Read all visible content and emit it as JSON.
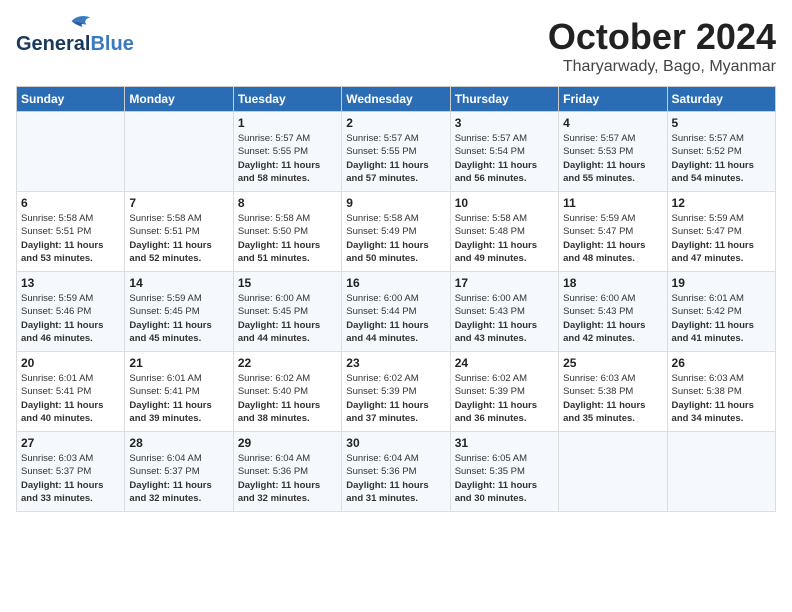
{
  "header": {
    "logo_general": "General",
    "logo_blue": "Blue",
    "month_year": "October 2024",
    "location": "Tharyarwady, Bago, Myanmar"
  },
  "days_of_week": [
    "Sunday",
    "Monday",
    "Tuesday",
    "Wednesday",
    "Thursday",
    "Friday",
    "Saturday"
  ],
  "weeks": [
    [
      {
        "day": "",
        "info": ""
      },
      {
        "day": "",
        "info": ""
      },
      {
        "day": "1",
        "info": "Sunrise: 5:57 AM\nSunset: 5:55 PM\nDaylight: 11 hours and 58 minutes."
      },
      {
        "day": "2",
        "info": "Sunrise: 5:57 AM\nSunset: 5:55 PM\nDaylight: 11 hours and 57 minutes."
      },
      {
        "day": "3",
        "info": "Sunrise: 5:57 AM\nSunset: 5:54 PM\nDaylight: 11 hours and 56 minutes."
      },
      {
        "day": "4",
        "info": "Sunrise: 5:57 AM\nSunset: 5:53 PM\nDaylight: 11 hours and 55 minutes."
      },
      {
        "day": "5",
        "info": "Sunrise: 5:57 AM\nSunset: 5:52 PM\nDaylight: 11 hours and 54 minutes."
      }
    ],
    [
      {
        "day": "6",
        "info": "Sunrise: 5:58 AM\nSunset: 5:51 PM\nDaylight: 11 hours and 53 minutes."
      },
      {
        "day": "7",
        "info": "Sunrise: 5:58 AM\nSunset: 5:51 PM\nDaylight: 11 hours and 52 minutes."
      },
      {
        "day": "8",
        "info": "Sunrise: 5:58 AM\nSunset: 5:50 PM\nDaylight: 11 hours and 51 minutes."
      },
      {
        "day": "9",
        "info": "Sunrise: 5:58 AM\nSunset: 5:49 PM\nDaylight: 11 hours and 50 minutes."
      },
      {
        "day": "10",
        "info": "Sunrise: 5:58 AM\nSunset: 5:48 PM\nDaylight: 11 hours and 49 minutes."
      },
      {
        "day": "11",
        "info": "Sunrise: 5:59 AM\nSunset: 5:47 PM\nDaylight: 11 hours and 48 minutes."
      },
      {
        "day": "12",
        "info": "Sunrise: 5:59 AM\nSunset: 5:47 PM\nDaylight: 11 hours and 47 minutes."
      }
    ],
    [
      {
        "day": "13",
        "info": "Sunrise: 5:59 AM\nSunset: 5:46 PM\nDaylight: 11 hours and 46 minutes."
      },
      {
        "day": "14",
        "info": "Sunrise: 5:59 AM\nSunset: 5:45 PM\nDaylight: 11 hours and 45 minutes."
      },
      {
        "day": "15",
        "info": "Sunrise: 6:00 AM\nSunset: 5:45 PM\nDaylight: 11 hours and 44 minutes."
      },
      {
        "day": "16",
        "info": "Sunrise: 6:00 AM\nSunset: 5:44 PM\nDaylight: 11 hours and 44 minutes."
      },
      {
        "day": "17",
        "info": "Sunrise: 6:00 AM\nSunset: 5:43 PM\nDaylight: 11 hours and 43 minutes."
      },
      {
        "day": "18",
        "info": "Sunrise: 6:00 AM\nSunset: 5:43 PM\nDaylight: 11 hours and 42 minutes."
      },
      {
        "day": "19",
        "info": "Sunrise: 6:01 AM\nSunset: 5:42 PM\nDaylight: 11 hours and 41 minutes."
      }
    ],
    [
      {
        "day": "20",
        "info": "Sunrise: 6:01 AM\nSunset: 5:41 PM\nDaylight: 11 hours and 40 minutes."
      },
      {
        "day": "21",
        "info": "Sunrise: 6:01 AM\nSunset: 5:41 PM\nDaylight: 11 hours and 39 minutes."
      },
      {
        "day": "22",
        "info": "Sunrise: 6:02 AM\nSunset: 5:40 PM\nDaylight: 11 hours and 38 minutes."
      },
      {
        "day": "23",
        "info": "Sunrise: 6:02 AM\nSunset: 5:39 PM\nDaylight: 11 hours and 37 minutes."
      },
      {
        "day": "24",
        "info": "Sunrise: 6:02 AM\nSunset: 5:39 PM\nDaylight: 11 hours and 36 minutes."
      },
      {
        "day": "25",
        "info": "Sunrise: 6:03 AM\nSunset: 5:38 PM\nDaylight: 11 hours and 35 minutes."
      },
      {
        "day": "26",
        "info": "Sunrise: 6:03 AM\nSunset: 5:38 PM\nDaylight: 11 hours and 34 minutes."
      }
    ],
    [
      {
        "day": "27",
        "info": "Sunrise: 6:03 AM\nSunset: 5:37 PM\nDaylight: 11 hours and 33 minutes."
      },
      {
        "day": "28",
        "info": "Sunrise: 6:04 AM\nSunset: 5:37 PM\nDaylight: 11 hours and 32 minutes."
      },
      {
        "day": "29",
        "info": "Sunrise: 6:04 AM\nSunset: 5:36 PM\nDaylight: 11 hours and 32 minutes."
      },
      {
        "day": "30",
        "info": "Sunrise: 6:04 AM\nSunset: 5:36 PM\nDaylight: 11 hours and 31 minutes."
      },
      {
        "day": "31",
        "info": "Sunrise: 6:05 AM\nSunset: 5:35 PM\nDaylight: 11 hours and 30 minutes."
      },
      {
        "day": "",
        "info": ""
      },
      {
        "day": "",
        "info": ""
      }
    ]
  ]
}
